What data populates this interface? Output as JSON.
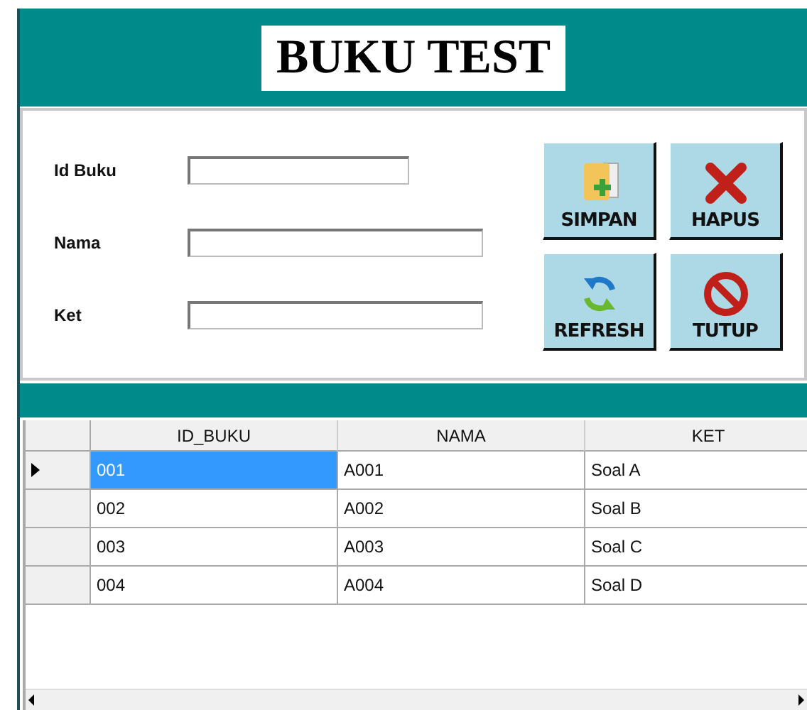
{
  "header": {
    "title": "BUKU TEST"
  },
  "form": {
    "fields": [
      {
        "label": "Id Buku",
        "wide": false
      },
      {
        "label": "Nama",
        "wide": true
      },
      {
        "label": "Ket",
        "wide": true
      }
    ]
  },
  "buttons": [
    {
      "label": "SIMPAN",
      "kind": "save"
    },
    {
      "label": "HAPUS",
      "kind": "delete"
    },
    {
      "label": "REFRESH",
      "kind": "refresh"
    },
    {
      "label": "TUTUP",
      "kind": "close"
    }
  ],
  "table": {
    "columns": [
      "ID_BUKU",
      "NAMA",
      "KET"
    ],
    "rows": [
      {
        "cells": [
          "001",
          "A001",
          "Soal A"
        ],
        "selected": true
      },
      {
        "cells": [
          "002",
          "A002",
          "Soal B"
        ],
        "selected": false
      },
      {
        "cells": [
          "003",
          "A003",
          "Soal C"
        ],
        "selected": false
      },
      {
        "cells": [
          "004",
          "A004",
          "Soal D"
        ],
        "selected": false
      }
    ]
  }
}
